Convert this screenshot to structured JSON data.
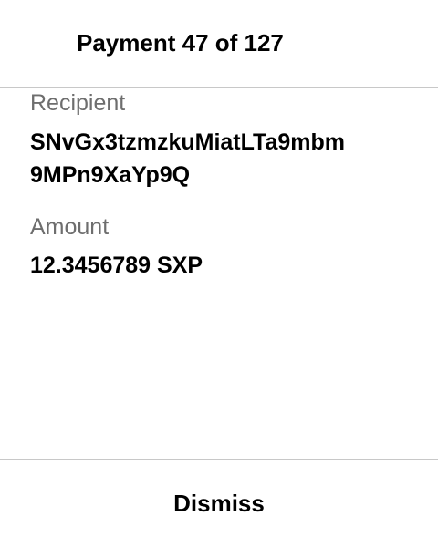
{
  "header": {
    "title": "Payment 47 of 127"
  },
  "recipient": {
    "label": "Recipient",
    "address_line1": "SNvGx3tzmzkuMiatLTa9mbm",
    "address_line2": "9MPn9XaYp9Q"
  },
  "amount": {
    "label": "Amount",
    "value": "12.3456789 SXP"
  },
  "footer": {
    "dismiss_label": "Dismiss"
  }
}
